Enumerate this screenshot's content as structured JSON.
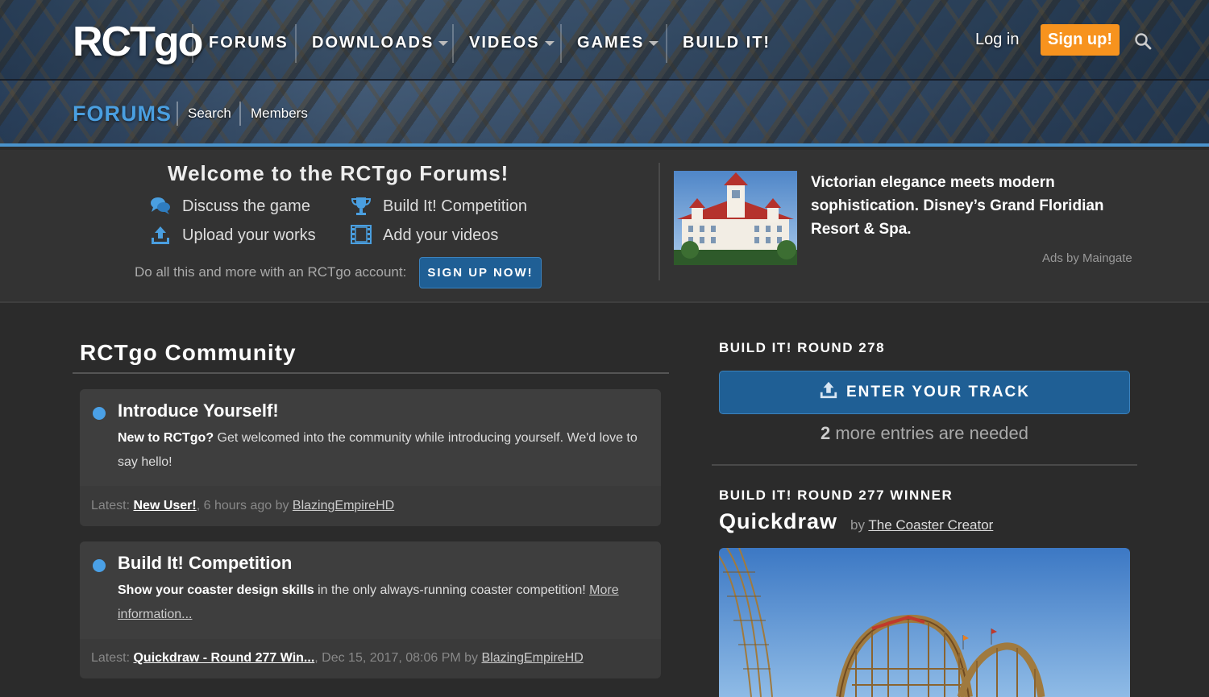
{
  "header": {
    "logo": "RCTgo",
    "nav": [
      {
        "label": "FORUMS",
        "dropdown": false
      },
      {
        "label": "DOWNLOADS",
        "dropdown": true
      },
      {
        "label": "VIDEOS",
        "dropdown": true
      },
      {
        "label": "GAMES",
        "dropdown": true
      },
      {
        "label": "BUILD IT!",
        "dropdown": false
      }
    ],
    "login": "Log in",
    "signup": "Sign up!",
    "search_icon": "search-icon"
  },
  "subnav": {
    "title": "FORUMS",
    "links": [
      "Search",
      "Members"
    ]
  },
  "welcome": {
    "title": "Welcome to the RCTgo Forums!",
    "features": [
      {
        "label": "Discuss the game",
        "icon": "chat-icon"
      },
      {
        "label": "Build It! Competition",
        "icon": "trophy-icon"
      },
      {
        "label": "Upload your works",
        "icon": "upload-icon"
      },
      {
        "label": "Add your videos",
        "icon": "film-icon"
      }
    ],
    "prompt": "Do all this and more with an RCTgo account:",
    "cta": "SIGN UP NOW!"
  },
  "ad": {
    "text": "Victorian elegance meets modern sophistication. Disney’s Grand Floridian Resort & Spa.",
    "attribution": "Ads by Maingate"
  },
  "community": {
    "title": "RCTgo Community",
    "forums": [
      {
        "title": "Introduce Yourself!",
        "desc_bold": "New to RCTgo?",
        "desc": " Get welcomed into the community while introducing yourself. We'd love to say hello!",
        "latest_label": "Latest:",
        "latest_thread": "New User!",
        "latest_time": ", 6 hours ago by ",
        "latest_user": "BlazingEmpireHD"
      },
      {
        "title": "Build It! Competition",
        "desc_bold": "Show your coaster design skills",
        "desc": " in the only always-running coaster competition! ",
        "desc_link": "More information...",
        "latest_label": "Latest:",
        "latest_thread": "Quickdraw - Round 277 Win...",
        "latest_time": ", Dec 15, 2017, 08:06 PM by ",
        "latest_user": "BlazingEmpireHD"
      }
    ]
  },
  "sidebar": {
    "round_heading": "BUILD IT! ROUND 278",
    "enter_button": "ENTER YOUR TRACK",
    "entries_count": "2",
    "entries_text": " more entries are needed",
    "winner_heading": "BUILD IT! ROUND 277 WINNER",
    "winner_name": "Quickdraw",
    "winner_by": "by ",
    "winner_author": "The Coaster Creator"
  }
}
